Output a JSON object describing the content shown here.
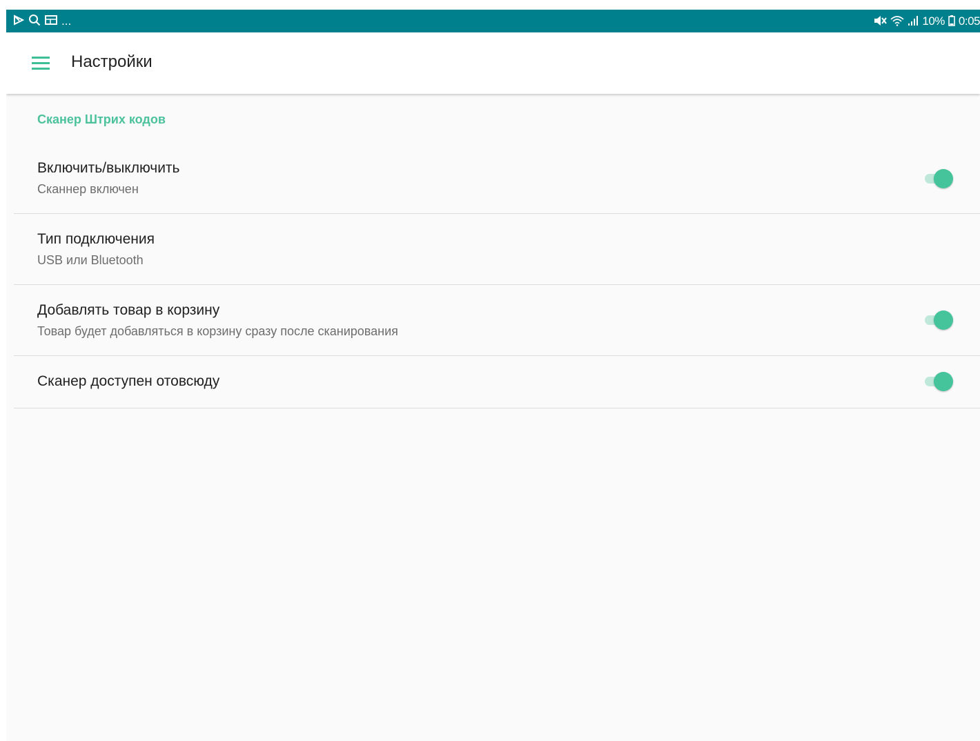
{
  "status_bar": {
    "left_icons": [
      "play-store-icon",
      "search-icon",
      "gallery-icon"
    ],
    "more": "...",
    "right_icons": [
      "mute-icon",
      "wifi-icon",
      "signal-icon",
      "battery-icon"
    ],
    "battery": "10%",
    "time": "0:05"
  },
  "app_bar": {
    "title": "Настройки",
    "menu_icon": "hamburger-menu-icon"
  },
  "section": {
    "header": "Сканер Штрих кодов",
    "accent_color": "#4cc29c"
  },
  "preferences": [
    {
      "title": "Включить/выключить",
      "summary": "Сканнер включен",
      "switch_on": true
    },
    {
      "title": "Тип подключения",
      "summary": "USB или Bluetooth"
    },
    {
      "title": "Добавлять товар в корзину",
      "summary": "Товар будет добавляться в корзину сразу после сканирования",
      "switch_on": true
    },
    {
      "title": "Сканер доступен отовсюду",
      "switch_on": true
    }
  ],
  "colors": {
    "status_bar": "#00808c",
    "switch_thumb": "#45c39b",
    "switch_track": "#bfe8da"
  }
}
